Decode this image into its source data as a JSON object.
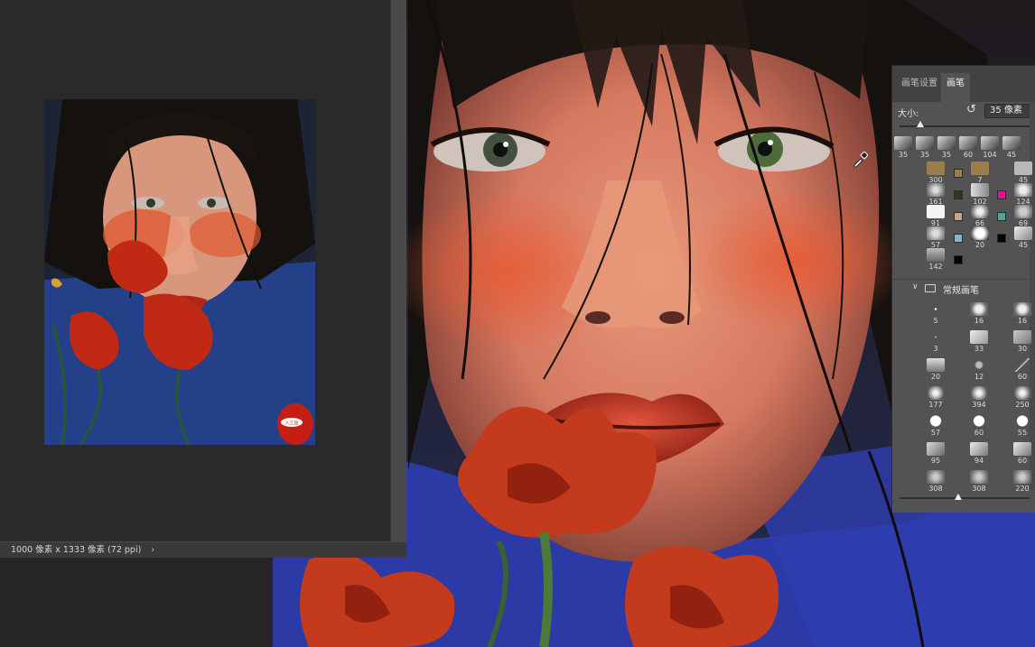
{
  "reference_window": {
    "status_text": "1000 像素 x 1333 像素 (72 ppi)",
    "status_chevron": "›",
    "watermark": "人工效"
  },
  "brush_panel": {
    "tabs": [
      {
        "label": "画笔设置",
        "active": false
      },
      {
        "label": "画笔",
        "active": true
      }
    ],
    "size_label": "大小:",
    "size_value": "35 像素",
    "size_fraction": 0.16,
    "reset_icon": "reset-icon",
    "folder_label": "常规画笔",
    "top_row": [
      "35",
      "35",
      "35",
      "60",
      "104",
      "45"
    ],
    "group_rows": [
      {
        "left": "300",
        "mid": "7",
        "right": "45"
      },
      {
        "left": "161",
        "mid": "102",
        "right": "124"
      },
      {
        "left": "91",
        "mid": "66",
        "right": "69"
      },
      {
        "left": "57",
        "mid": "20",
        "right": "45"
      },
      {
        "left": "142",
        "mid": "",
        "right": ""
      }
    ],
    "preset_rows": [
      [
        "5",
        "16",
        "16"
      ],
      [
        "3",
        "33",
        "30"
      ],
      [
        "20",
        "12",
        "60"
      ],
      [
        "177",
        "394",
        "250"
      ],
      [
        "57",
        "60",
        "55"
      ],
      [
        "95",
        "94",
        "60"
      ],
      [
        "308",
        "308",
        "220"
      ]
    ],
    "swatch_colors": [
      "#9b7e4b",
      "#2d3a1e",
      "#c9a687",
      "#86b7cf",
      "#d71890",
      "#4aa89b",
      "#000000",
      "#ffffff",
      "#000000"
    ]
  },
  "colors": {
    "app_bg": "#262626",
    "panel_bg": "#535353",
    "tab_bg": "#424242",
    "accent_red": "#c8381c"
  }
}
